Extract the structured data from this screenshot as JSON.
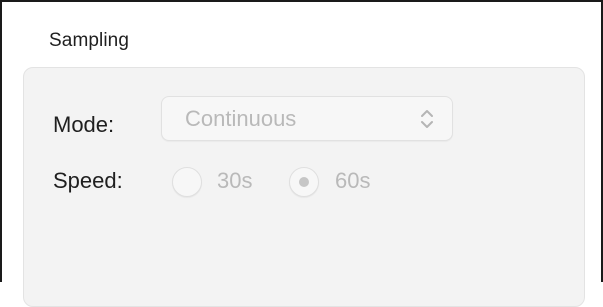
{
  "section": {
    "title": "Sampling"
  },
  "mode": {
    "label": "Mode:",
    "selected": "Continuous",
    "enabled": false
  },
  "speed": {
    "label": "Speed:",
    "options": [
      {
        "label": "30s",
        "selected": false
      },
      {
        "label": "60s",
        "selected": true
      }
    ],
    "enabled": false
  },
  "colors": {
    "disabled_text": "#b9b9b9",
    "group_background": "#f3f3f3",
    "label_text": "#1f1f1f"
  }
}
